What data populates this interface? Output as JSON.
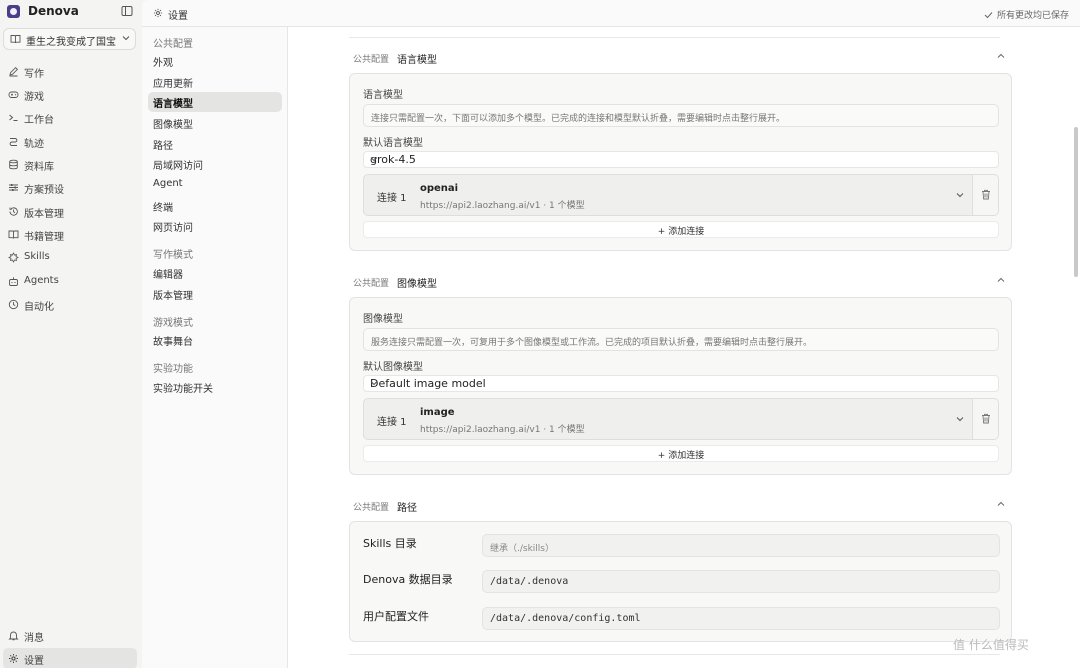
{
  "app": {
    "name": "Denova",
    "project": "重生之我变成了国宝"
  },
  "nav": {
    "items": [
      {
        "label": "写作",
        "icon": "pen-icon"
      },
      {
        "label": "游戏",
        "icon": "gamepad-icon"
      },
      {
        "label": "工作台",
        "icon": "terminal-icon"
      },
      {
        "label": "轨迹",
        "icon": "route-icon"
      },
      {
        "label": "资料库",
        "icon": "database-icon"
      },
      {
        "label": "方案预设",
        "icon": "sliders-icon"
      },
      {
        "label": "版本管理",
        "icon": "history-icon"
      },
      {
        "label": "书籍管理",
        "icon": "book-icon"
      },
      {
        "label": "Skills",
        "icon": "puzzle-icon"
      },
      {
        "label": "Agents",
        "icon": "bot-icon"
      },
      {
        "label": "自动化",
        "icon": "clock-icon"
      }
    ],
    "bottom": [
      {
        "label": "消息",
        "icon": "bell-icon"
      },
      {
        "label": "设置",
        "icon": "gear-icon"
      }
    ]
  },
  "topbar": {
    "title": "设置",
    "saved_status": "所有更改均已保存"
  },
  "settings_nav": {
    "sections": [
      {
        "label": "公共配置",
        "items": [
          "外观",
          "应用更新",
          "语言模型",
          "图像模型",
          "路径",
          "局域网访问",
          "Agent",
          "终端",
          "网页访问"
        ]
      },
      {
        "label": "写作模式",
        "items": [
          "编辑器",
          "版本管理"
        ]
      },
      {
        "label": "游戏模式",
        "items": [
          "故事舞台"
        ]
      },
      {
        "label": "实验功能",
        "items": [
          "实验功能开关"
        ]
      }
    ],
    "active": "语言模型"
  },
  "language_model": {
    "scope": "公共配置",
    "title": "语言模型",
    "label": "语言模型",
    "hint": "连接只需配置一次，下面可以添加多个模型。已完成的连接和模型默认折叠，需要编辑时点击整行展开。",
    "default_label": "默认语言模型",
    "default_value": "grok-4.5",
    "connection": {
      "index": "连接 1",
      "name": "openai",
      "detail": "https://api2.laozhang.ai/v1 · 1 个模型"
    },
    "add_connection": "+ 添加连接"
  },
  "image_model": {
    "scope": "公共配置",
    "title": "图像模型",
    "label": "图像模型",
    "hint": "服务连接只需配置一次，可复用于多个图像模型或工作流。已完成的项目默认折叠，需要编辑时点击整行展开。",
    "default_label": "默认图像模型",
    "default_value": "Default image model",
    "connection": {
      "index": "连接 1",
      "name": "image",
      "detail": "https://api2.laozhang.ai/v1 · 1 个模型"
    },
    "add_connection": "+ 添加连接"
  },
  "paths": {
    "scope": "公共配置",
    "title": "路径",
    "rows": [
      {
        "label": "Skills 目录",
        "value": "",
        "placeholder": "继承（./skills）"
      },
      {
        "label": "Denova 数据目录",
        "value": "/data/.denova",
        "placeholder": ""
      },
      {
        "label": "用户配置文件",
        "value": "/data/.denova/config.toml",
        "placeholder": ""
      }
    ]
  },
  "watermark": "值 什么值得买"
}
